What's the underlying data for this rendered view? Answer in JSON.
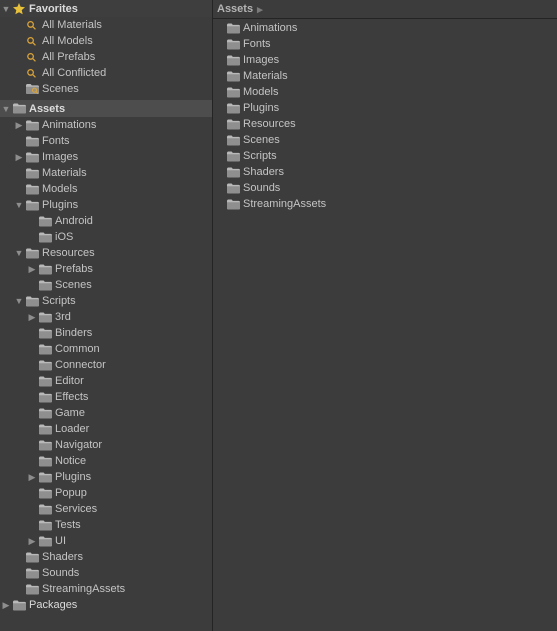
{
  "favorites": {
    "title": "Favorites",
    "items": [
      {
        "label": "All Materials"
      },
      {
        "label": "All Models"
      },
      {
        "label": "All Prefabs"
      },
      {
        "label": "All Conflicted"
      },
      {
        "label": "Scenes",
        "icon": "folder"
      }
    ]
  },
  "assets": {
    "title": "Assets",
    "tree": [
      {
        "label": "Animations",
        "arrow": "right",
        "depth": 0
      },
      {
        "label": "Fonts",
        "arrow": "",
        "depth": 0
      },
      {
        "label": "Images",
        "arrow": "right",
        "depth": 0
      },
      {
        "label": "Materials",
        "arrow": "",
        "depth": 0
      },
      {
        "label": "Models",
        "arrow": "",
        "depth": 0
      },
      {
        "label": "Plugins",
        "arrow": "down",
        "depth": 0
      },
      {
        "label": "Android",
        "arrow": "",
        "depth": 1
      },
      {
        "label": "iOS",
        "arrow": "",
        "depth": 1
      },
      {
        "label": "Resources",
        "arrow": "down",
        "depth": 0
      },
      {
        "label": "Prefabs",
        "arrow": "right",
        "depth": 1
      },
      {
        "label": "Scenes",
        "arrow": "",
        "depth": 1
      },
      {
        "label": "Scripts",
        "arrow": "down",
        "depth": 0
      },
      {
        "label": "3rd",
        "arrow": "right",
        "depth": 1
      },
      {
        "label": "Binders",
        "arrow": "",
        "depth": 1
      },
      {
        "label": "Common",
        "arrow": "",
        "depth": 1
      },
      {
        "label": "Connector",
        "arrow": "",
        "depth": 1
      },
      {
        "label": "Editor",
        "arrow": "",
        "depth": 1
      },
      {
        "label": "Effects",
        "arrow": "",
        "depth": 1
      },
      {
        "label": "Game",
        "arrow": "",
        "depth": 1
      },
      {
        "label": "Loader",
        "arrow": "",
        "depth": 1
      },
      {
        "label": "Navigator",
        "arrow": "",
        "depth": 1
      },
      {
        "label": "Notice",
        "arrow": "",
        "depth": 1
      },
      {
        "label": "Plugins",
        "arrow": "right",
        "depth": 1
      },
      {
        "label": "Popup",
        "arrow": "",
        "depth": 1
      },
      {
        "label": "Services",
        "arrow": "",
        "depth": 1
      },
      {
        "label": "Tests",
        "arrow": "",
        "depth": 1
      },
      {
        "label": "UI",
        "arrow": "right",
        "depth": 1
      },
      {
        "label": "Shaders",
        "arrow": "",
        "depth": 0
      },
      {
        "label": "Sounds",
        "arrow": "",
        "depth": 0
      },
      {
        "label": "StreamingAssets",
        "arrow": "",
        "depth": 0
      }
    ]
  },
  "packages": {
    "title": "Packages"
  },
  "breadcrumb": {
    "root": "Assets"
  },
  "right_items": [
    {
      "label": "Animations"
    },
    {
      "label": "Fonts"
    },
    {
      "label": "Images"
    },
    {
      "label": "Materials"
    },
    {
      "label": "Models"
    },
    {
      "label": "Plugins"
    },
    {
      "label": "Resources"
    },
    {
      "label": "Scenes"
    },
    {
      "label": "Scripts"
    },
    {
      "label": "Shaders"
    },
    {
      "label": "Sounds"
    },
    {
      "label": "StreamingAssets"
    }
  ]
}
